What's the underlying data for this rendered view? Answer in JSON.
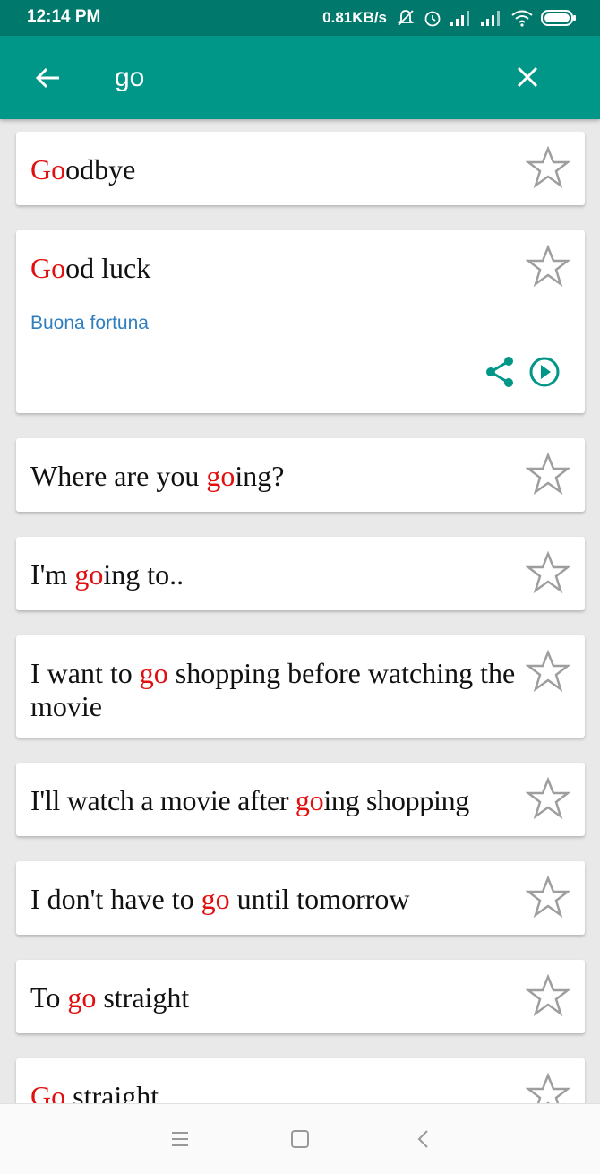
{
  "status_bar": {
    "time": "12:14 PM",
    "network_speed": "0.81KB/s",
    "icons": [
      "mute-icon",
      "alarm-icon",
      "signal-icon",
      "signal-icon",
      "wifi-icon",
      "battery-icon"
    ]
  },
  "app_bar": {
    "back_icon": "arrow-left-icon",
    "search_value": "go",
    "clear_icon": "close-icon"
  },
  "theme": {
    "primary": "#009688",
    "status": "#00786c",
    "highlight": "#e01010",
    "translation": "#2f7fc0",
    "star": "#9e9e9e"
  },
  "results": [
    {
      "before": "",
      "match": "Go",
      "after": "odbye"
    },
    {
      "before": "",
      "match": "Go",
      "after": "od luck",
      "translation": "Buona fortuna",
      "expanded": true
    },
    {
      "before": "Where are you ",
      "match": "go",
      "after": "ing?"
    },
    {
      "before": "I'm ",
      "match": "go",
      "after": "ing to.."
    },
    {
      "before": "I want to ",
      "match": "go",
      "after": " shopping before watching the movie"
    },
    {
      "before": "I'll watch a movie after ",
      "match": "go",
      "after": "ing shopping"
    },
    {
      "before": "I don't have to ",
      "match": "go",
      "after": " until tomorrow"
    },
    {
      "before": "To ",
      "match": "go",
      "after": " straight"
    },
    {
      "before": "",
      "match": "Go",
      "after": " straight"
    }
  ],
  "nav_bar": {
    "icons": [
      "menu-icon",
      "home-square-icon",
      "back-chevron-icon"
    ]
  }
}
